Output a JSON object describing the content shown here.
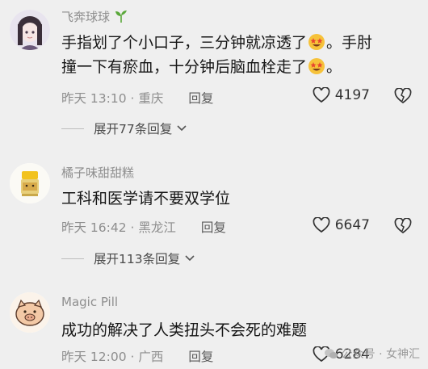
{
  "comments": [
    {
      "username": "飞奔球球",
      "text_line1_a": "手指划了个小口子，三分钟就凉透了",
      "text_line1_b": "。手肘",
      "text_line2_a": "撞一下有瘀血，十分钟后脑血栓走了",
      "text_line2_b": "。",
      "time": "昨天 13:10",
      "location": "重庆",
      "reply_label": "回复",
      "likes": "4197",
      "expand_label": "展开77条回复"
    },
    {
      "username": "橘子味甜甜糕",
      "text": "工科和医学请不要双学位",
      "time": "昨天 16:42",
      "location": "黑龙江",
      "reply_label": "回复",
      "likes": "6647",
      "expand_label": "展开113条回复"
    },
    {
      "username": "Magic Pill",
      "text": "成功的解决了人类扭头不会死的难题",
      "time": "昨天 12:00",
      "location": "广西",
      "reply_label": "回复",
      "likes": "6284"
    }
  ],
  "watermark": {
    "text": "公众号 · 女神汇"
  },
  "colors": {
    "background": "#efefef",
    "meta_gray": "#8e8e8e",
    "sprout_green": "#5aa83a"
  }
}
